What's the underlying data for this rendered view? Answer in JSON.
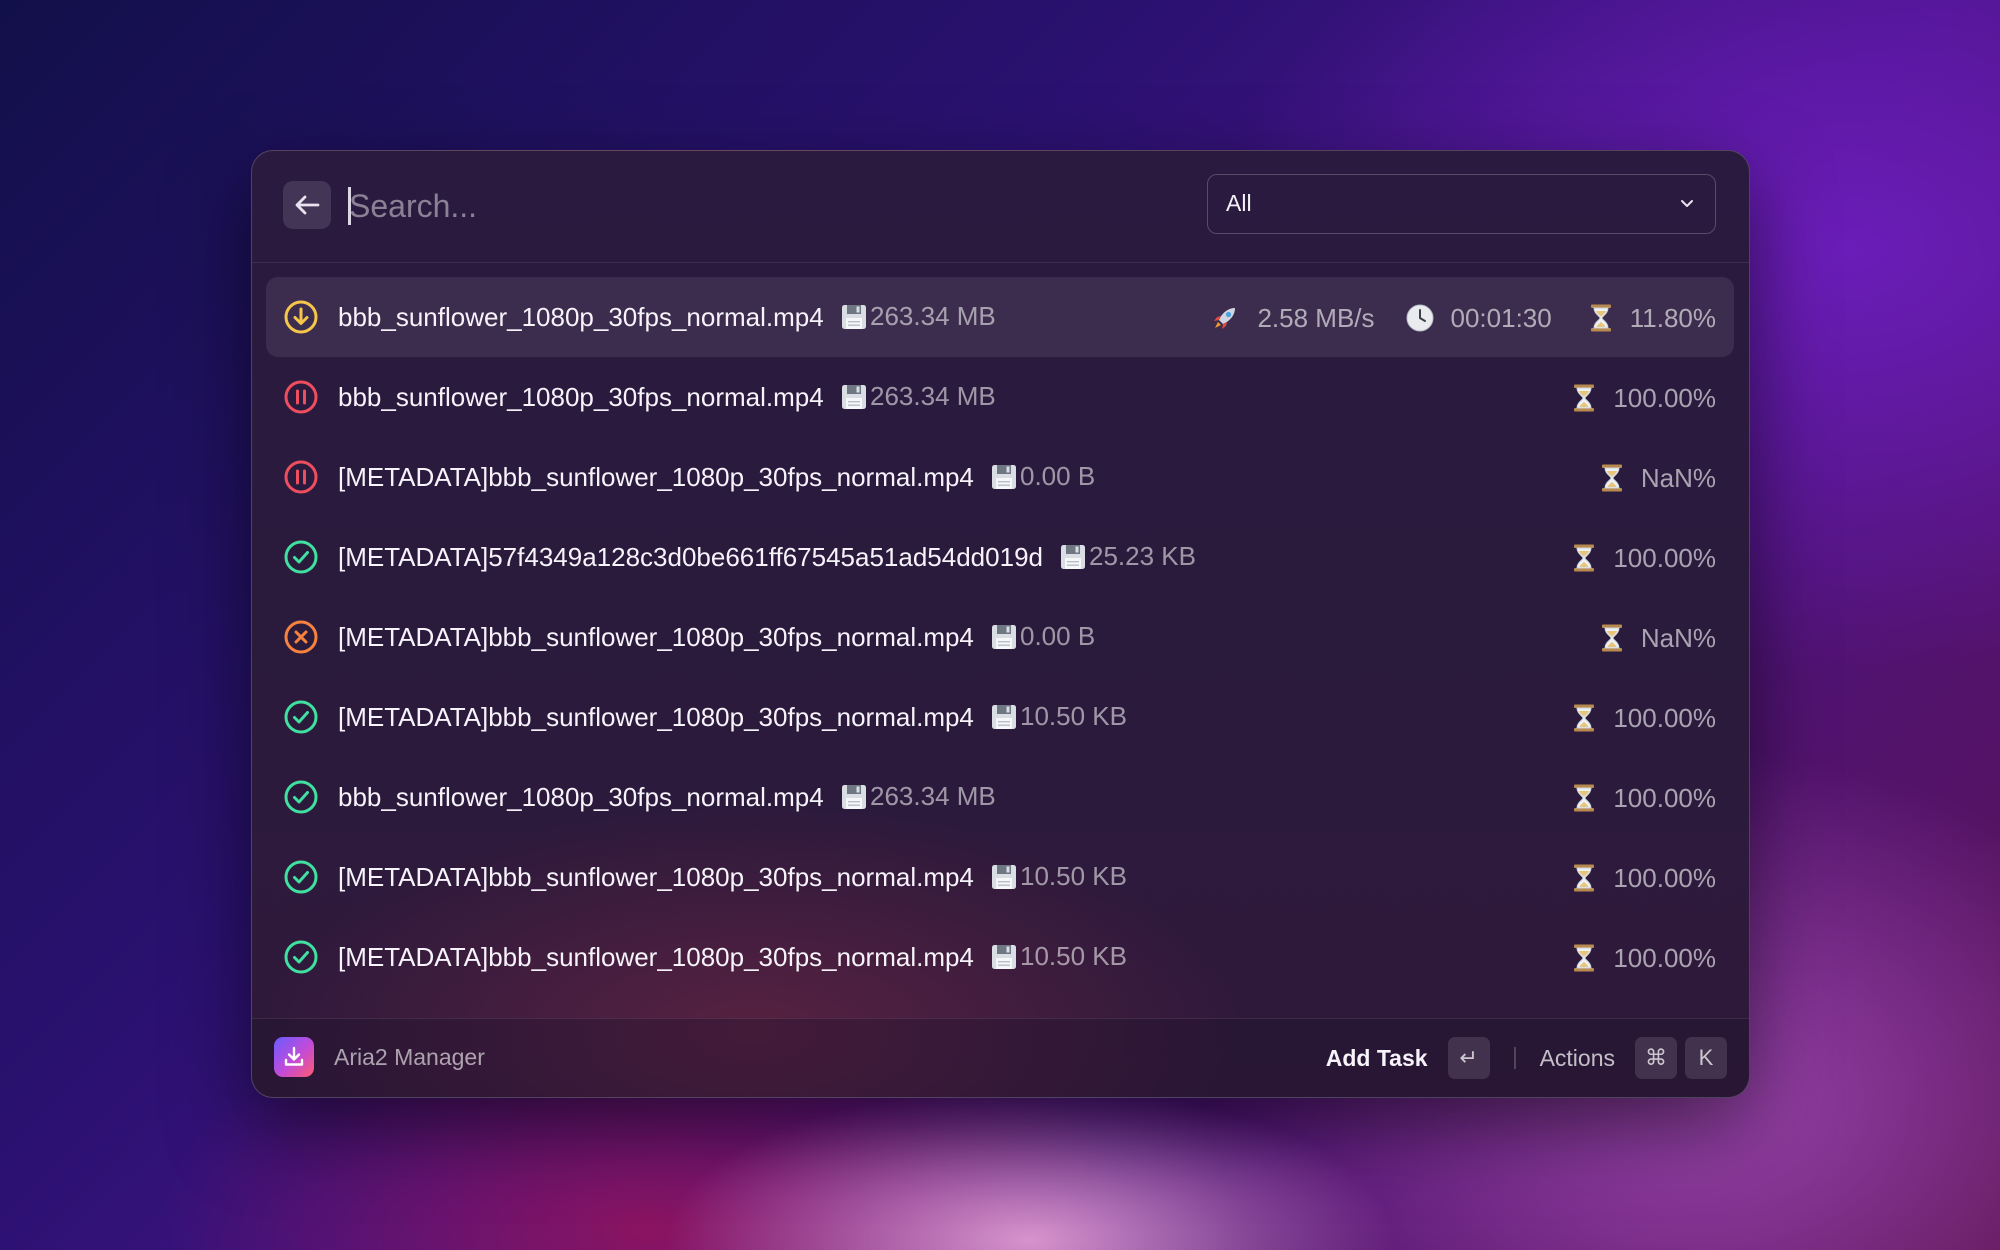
{
  "search": {
    "placeholder": "Search...",
    "value": ""
  },
  "filter": {
    "selected": "All"
  },
  "tasks": [
    {
      "status": "downloading",
      "status_icon": "download-circle-icon",
      "status_color": "#f5c64a",
      "name": "bbb_sunflower_1080p_30fps_normal.mp4",
      "size": "263.34 MB",
      "speed": "2.58 MB/s",
      "eta": "00:01:30",
      "progress": "11.80%",
      "selected": true
    },
    {
      "status": "paused",
      "status_icon": "pause-circle-icon",
      "status_color": "#ef4e5e",
      "name": "bbb_sunflower_1080p_30fps_normal.mp4",
      "size": "263.34 MB",
      "progress": "100.00%"
    },
    {
      "status": "paused",
      "status_icon": "pause-circle-icon",
      "status_color": "#ef4e5e",
      "name": "[METADATA]bbb_sunflower_1080p_30fps_normal.mp4",
      "size": "0.00 B",
      "progress": "NaN%"
    },
    {
      "status": "complete",
      "status_icon": "check-circle-icon",
      "status_color": "#3fe0a0",
      "name": "[METADATA]57f4349a128c3d0be661ff67545a51ad54dd019d",
      "size": "25.23 KB",
      "progress": "100.00%"
    },
    {
      "status": "error",
      "status_icon": "x-circle-icon",
      "status_color": "#f5833f",
      "name": "[METADATA]bbb_sunflower_1080p_30fps_normal.mp4",
      "size": "0.00 B",
      "progress": "NaN%"
    },
    {
      "status": "complete",
      "status_icon": "check-circle-icon",
      "status_color": "#3fe0a0",
      "name": "[METADATA]bbb_sunflower_1080p_30fps_normal.mp4",
      "size": "10.50 KB",
      "progress": "100.00%"
    },
    {
      "status": "complete",
      "status_icon": "check-circle-icon",
      "status_color": "#3fe0a0",
      "name": "bbb_sunflower_1080p_30fps_normal.mp4",
      "size": "263.34 MB",
      "progress": "100.00%"
    },
    {
      "status": "complete",
      "status_icon": "check-circle-icon",
      "status_color": "#3fe0a0",
      "name": "[METADATA]bbb_sunflower_1080p_30fps_normal.mp4",
      "size": "10.50 KB",
      "progress": "100.00%"
    },
    {
      "status": "complete",
      "status_icon": "check-circle-icon",
      "status_color": "#3fe0a0",
      "name": "[METADATA]bbb_sunflower_1080p_30fps_normal.mp4",
      "size": "10.50 KB",
      "progress": "100.00%"
    }
  ],
  "footer": {
    "app_name": "Aria2 Manager",
    "primary_action": "Add Task",
    "primary_shortcut": "↵",
    "actions_label": "Actions",
    "actions_shortcut": [
      "⌘",
      "K"
    ]
  }
}
